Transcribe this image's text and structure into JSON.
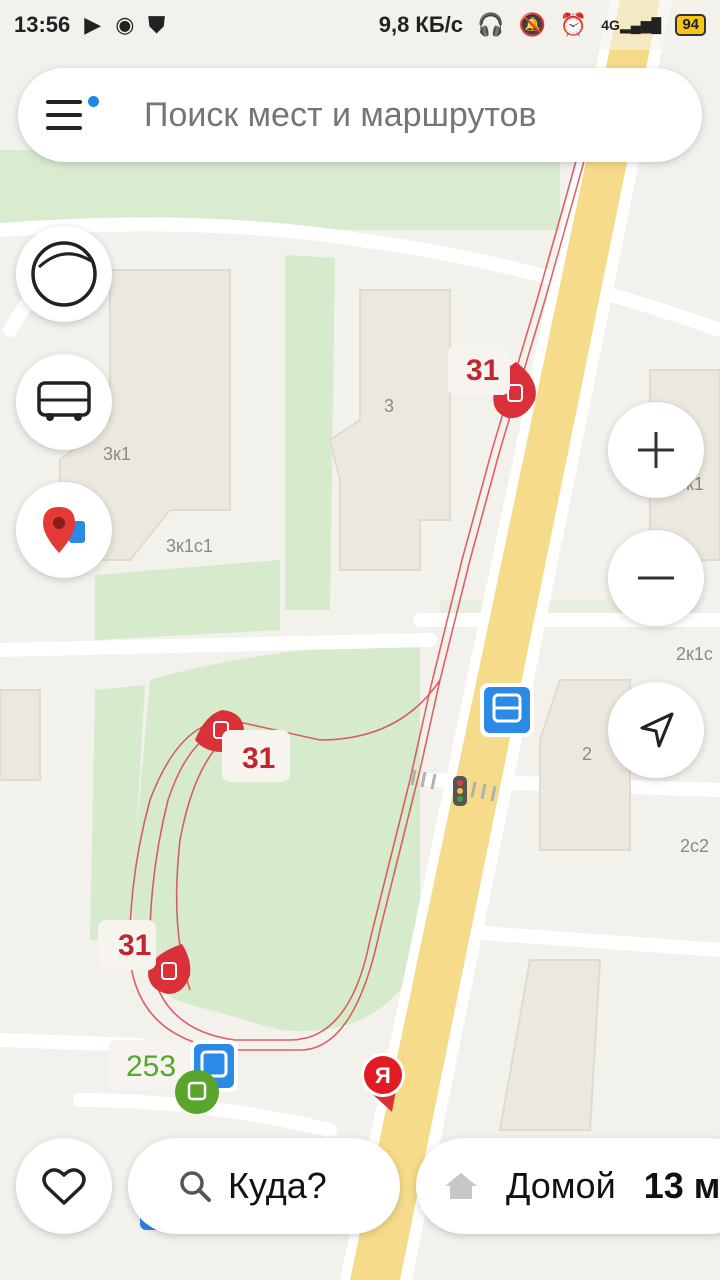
{
  "status_bar": {
    "time": "13:56",
    "network_speed": "9,8 КБ/с",
    "network_type": "4G",
    "battery": "94"
  },
  "search": {
    "placeholder": "Поиск мест и маршрутов"
  },
  "map": {
    "building_labels": [
      "3",
      "3к1",
      "3к1с1",
      "2к1с",
      "2",
      "2с2",
      "4к1"
    ],
    "route_number": "31",
    "bus_route_number": "253",
    "yandex_marker": "Я"
  },
  "bottom": {
    "where_label": "Куда?",
    "home_label": "Домой",
    "home_time": "13 м"
  },
  "colors": {
    "route": "#d9303a",
    "bus_stop": "#2b8ae6",
    "bus_green": "#5aa52b",
    "road_yellow": "#f6dc8a",
    "park_green": "#d6ebcb"
  }
}
